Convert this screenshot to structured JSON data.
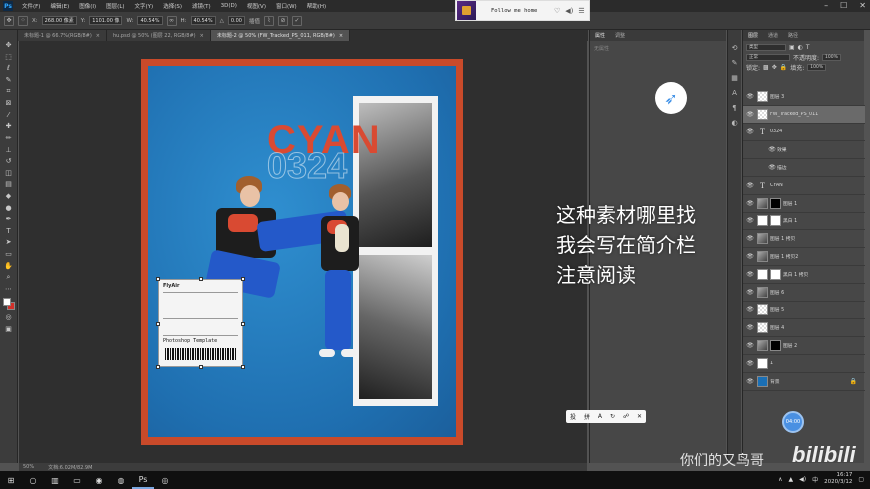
{
  "menubar": {
    "items": [
      "文件(F)",
      "编辑(E)",
      "图像(I)",
      "图层(L)",
      "文字(Y)",
      "选择(S)",
      "滤镜(T)",
      "3D(D)",
      "视图(V)",
      "窗口(W)",
      "帮助(H)"
    ]
  },
  "options": {
    "x_label": "X:",
    "x_value": "268.00 像素",
    "y_label": "Y:",
    "y_value": "1101.00 像",
    "w_label": "W:",
    "w_value": "40.54%",
    "h_label": "H:",
    "h_value": "40.54%",
    "angle_label": "△",
    "angle_value": "0.00",
    "interp_label": "插值",
    "cancel_icon": "cancel-icon",
    "commit_icon": "check-icon"
  },
  "music": {
    "title": "Follow me home"
  },
  "tabs": [
    {
      "label": "未标题-1 @ 66.7%(RGB/8#)",
      "active": false
    },
    {
      "label": "hu.psd @ 50% (图层 22, RGB/8#)",
      "active": false
    },
    {
      "label": "未标题-2 @ 50% (FW_Tracked_PS_011, RGB/8#)",
      "active": true
    }
  ],
  "poster": {
    "title": "CYAN",
    "number": "0324",
    "ticket": {
      "brand": "FlyAir",
      "title": "Photoshop Template"
    }
  },
  "overlay": {
    "line1": "这种素材哪里找",
    "line2": "我会写在简介栏",
    "line3": "注意阅读"
  },
  "mini_toolbar": {
    "items": [
      "投",
      "拼",
      "A",
      "↻",
      "☍",
      "✕"
    ]
  },
  "properties": {
    "tabs": [
      "属性",
      "调整"
    ],
    "placeholder": "无属性"
  },
  "layers": {
    "tabs": [
      "图层",
      "通道",
      "路径"
    ],
    "kind_placeholder": "类型",
    "blend_mode": "正常",
    "opacity_label": "不透明度:",
    "opacity_value": "100%",
    "lock_label": "锁定:",
    "fill_label": "填充:",
    "fill_value": "100%",
    "items": [
      {
        "name": "图层 3",
        "thumb": "checker",
        "selected": false
      },
      {
        "name": "FW_Tracked_PS_011",
        "thumb": "checker",
        "selected": true
      },
      {
        "name": "0324",
        "thumb": "text",
        "selected": false
      },
      {
        "name": "效果",
        "thumb": "none",
        "selected": false,
        "sub": true
      },
      {
        "name": "描边",
        "thumb": "none",
        "selected": false,
        "sub": true
      },
      {
        "name": "CYAN",
        "thumb": "text",
        "selected": false
      },
      {
        "name": "图层 1",
        "thumb": "img",
        "mask": "black",
        "selected": false
      },
      {
        "name": "黑白 1",
        "thumb": "white",
        "mask": "white",
        "selected": false
      },
      {
        "name": "图层 1 拷贝",
        "thumb": "img",
        "selected": false
      },
      {
        "name": "图层 1 拷贝2",
        "thumb": "img",
        "selected": false
      },
      {
        "name": "黑白 1 拷贝",
        "thumb": "white",
        "mask": "white",
        "selected": false
      },
      {
        "name": "图层 6",
        "thumb": "img",
        "selected": false
      },
      {
        "name": "图层 5",
        "thumb": "checker",
        "selected": false
      },
      {
        "name": "图层 4",
        "thumb": "checker",
        "selected": false
      },
      {
        "name": "图层 2",
        "thumb": "img",
        "mask": "black",
        "selected": false
      },
      {
        "name": "1",
        "thumb": "white",
        "selected": false
      },
      {
        "name": "背景",
        "thumb": "blue",
        "selected": false,
        "locked": true
      }
    ]
  },
  "status": {
    "zoom": "50%",
    "doc": "文档:6.02M/82.9M"
  },
  "watermark": {
    "text": "你们的又鸟哥",
    "brand": "bilibili"
  },
  "badge": {
    "text": "04:00"
  },
  "taskbar": {
    "time": "16:17",
    "date": "2020/3/12"
  },
  "colors": {
    "frame": "#c94a2a",
    "poster_blue": "#2f8fd0",
    "accent": "#d94a32"
  }
}
